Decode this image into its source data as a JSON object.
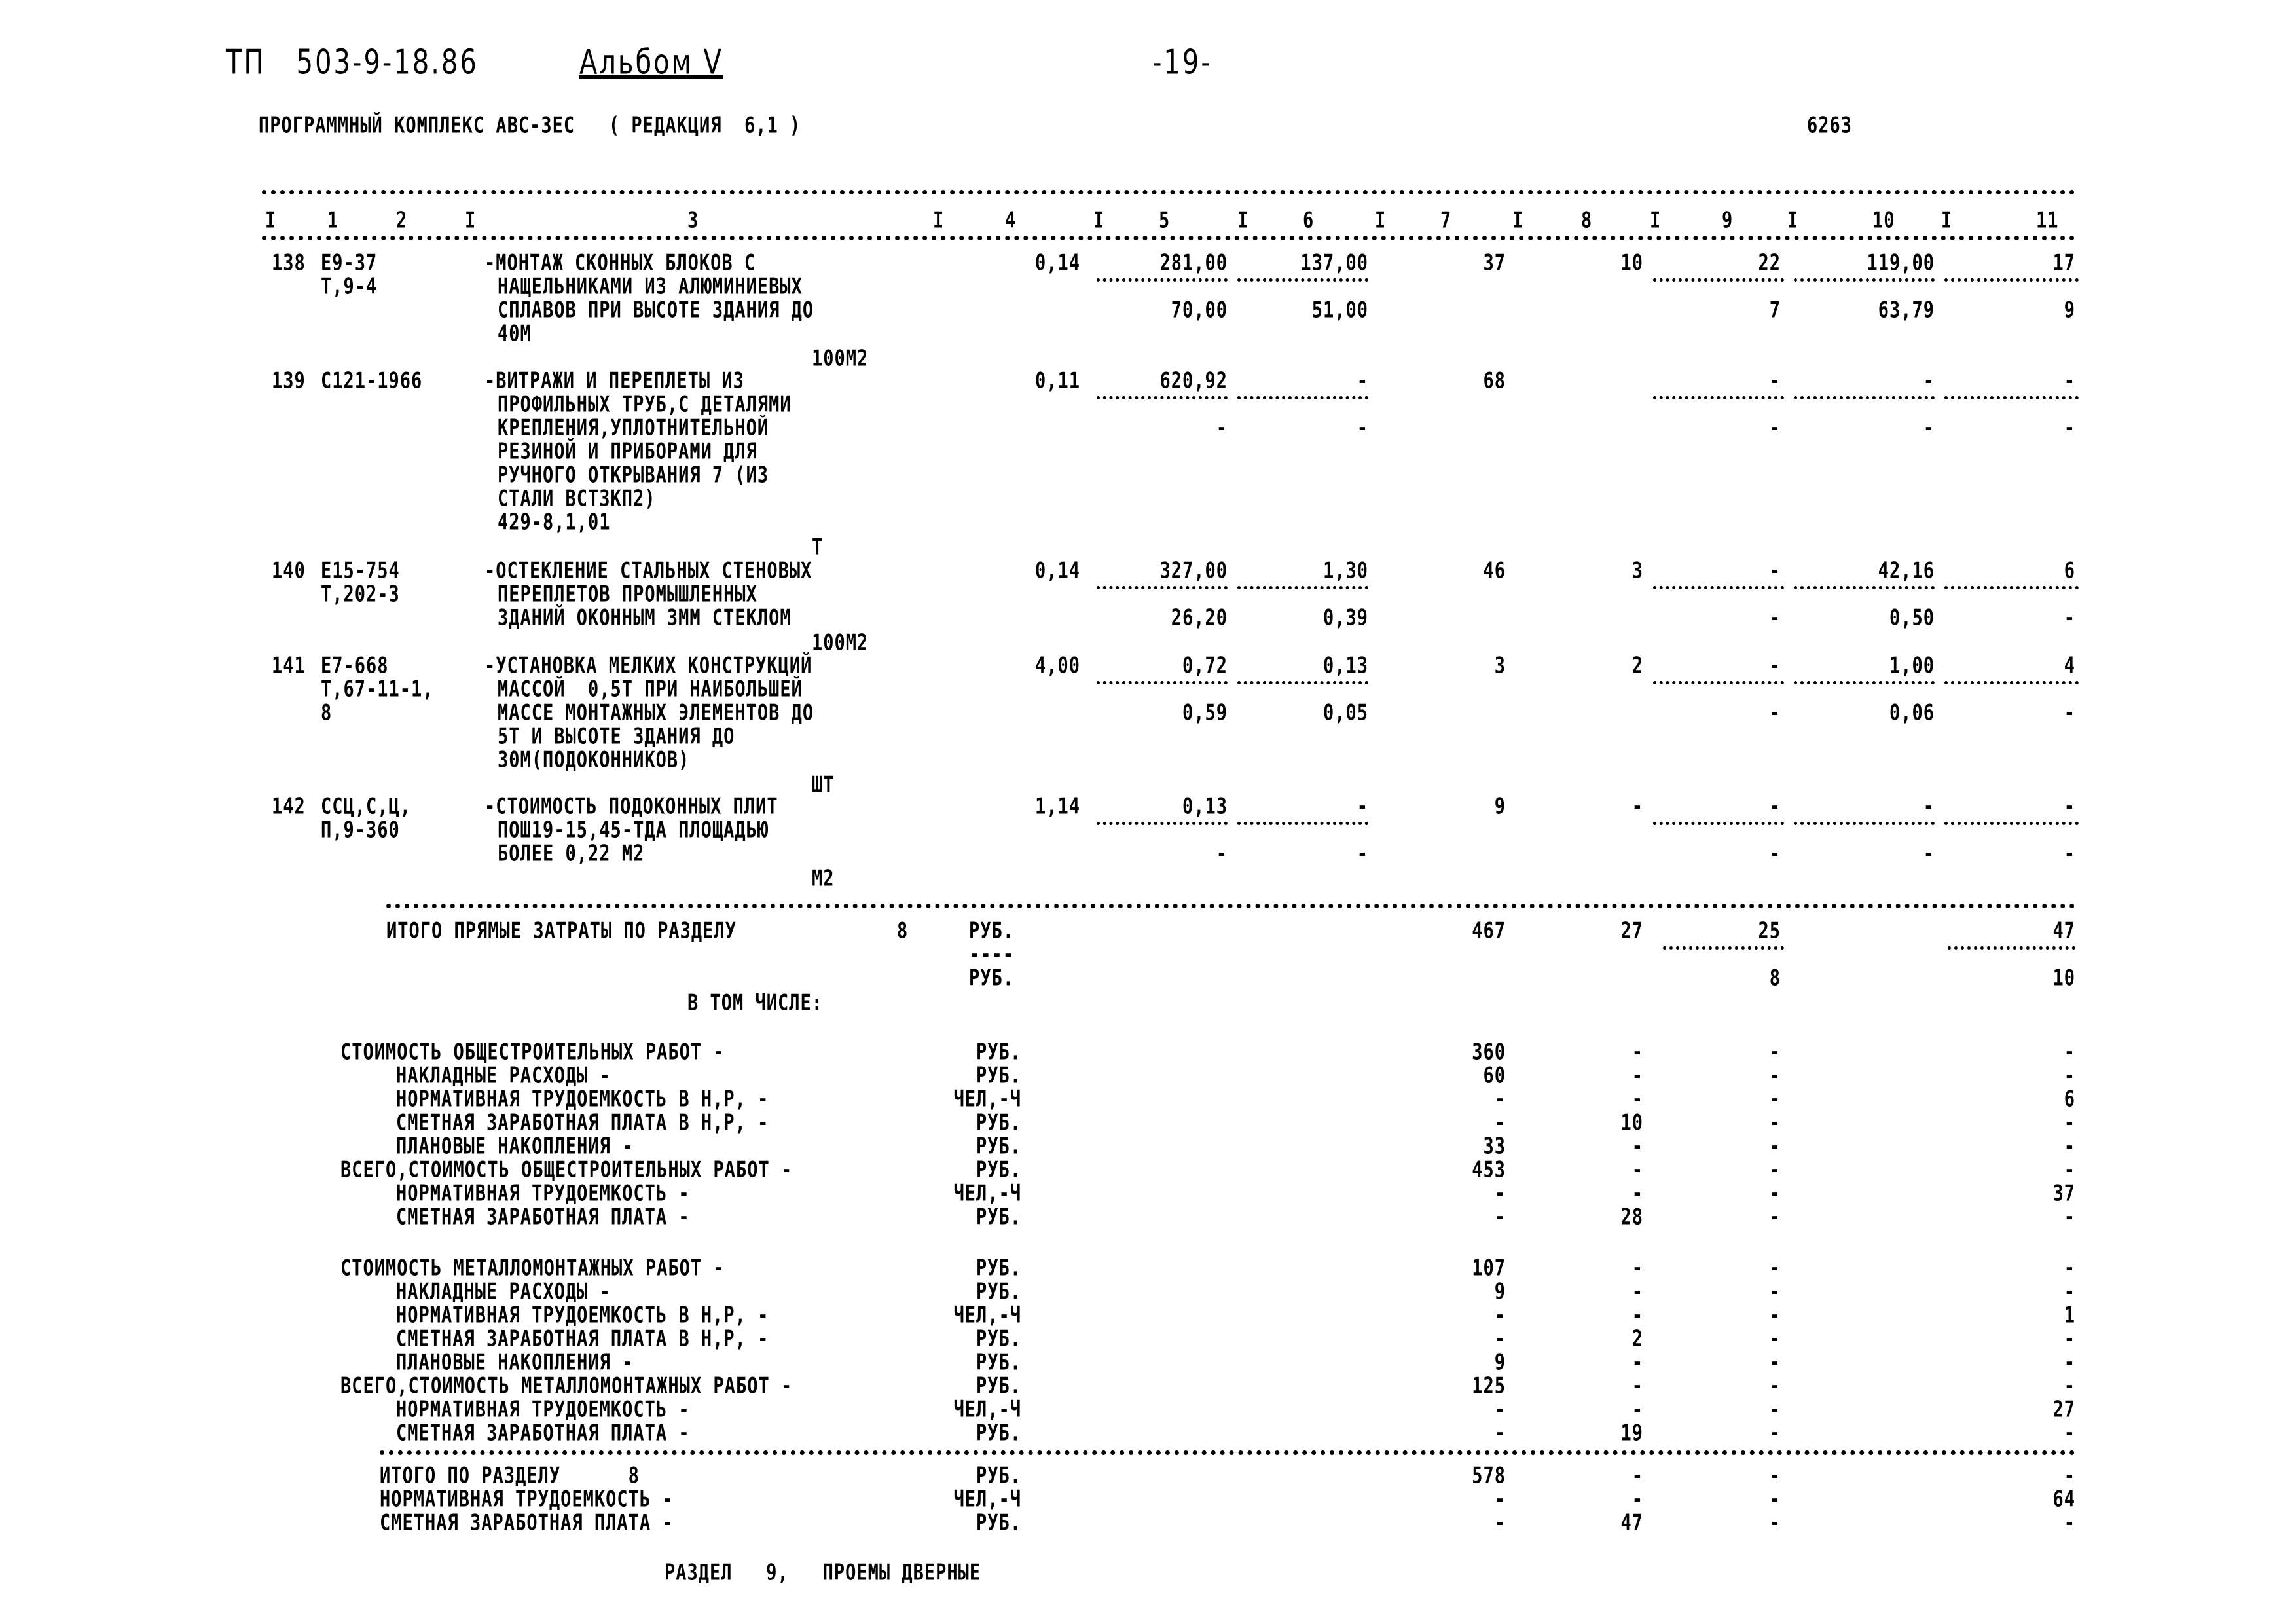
{
  "header": {
    "doc_code": "ТП   503-9-18.86",
    "album": "Альбом V",
    "page": "-19-",
    "program": "ПРОГРАММНЫЙ КОМПЛЕКС АВС-3ЕС   ( РЕДАКЦИЯ  6,1 )",
    "sheet_no": "6263"
  },
  "columns": [
    "1",
    "2",
    "3",
    "4",
    "5",
    "6",
    "7",
    "8",
    "9",
    "10",
    "11"
  ],
  "rows": [
    {
      "num": "138",
      "code": [
        "Е9-37",
        "Т,9-4"
      ],
      "desc": [
        "-МОНТАЖ СКОННЫХ БЛОКОВ С",
        "НАЩЕЛЬНИКАМИ ИЗ АЛЮМИНИЕВЫХ",
        "СПЛАВОВ ПРИ ВЫСОТЕ ЗДАНИЯ ДО",
        "40М"
      ],
      "unit": "100М2",
      "qty": "0,14",
      "c5": [
        "281,00",
        "70,00"
      ],
      "c6": [
        "137,00",
        "51,00"
      ],
      "c7": "37",
      "c8": "10",
      "c9": [
        "22",
        "7"
      ],
      "c10": [
        "119,00",
        "63,79"
      ],
      "c11": [
        "17",
        "9"
      ]
    },
    {
      "num": "139",
      "code": [
        "С121-1966"
      ],
      "desc": [
        "-ВИТРАЖИ И ПЕРЕПЛЕТЫ ИЗ",
        "ПРОФИЛЬНЫХ ТРУБ,С ДЕТАЛЯМИ",
        "КРЕПЛЕНИЯ,УПЛОТНИТЕЛЬНОЙ",
        "РЕЗИНОЙ И ПРИБОРАМИ ДЛЯ",
        "РУЧНОГО ОТКРЫВАНИЯ 7 (ИЗ",
        "СТАЛИ ВСТ3КП2)",
        "429-8,1,01"
      ],
      "unit": "Т",
      "qty": "0,11",
      "c5": [
        "620,92",
        "-"
      ],
      "c6": [
        "-",
        "-"
      ],
      "c7": "68",
      "c8": "",
      "c9": [
        "-",
        "-"
      ],
      "c10": [
        "-",
        "-"
      ],
      "c11": [
        "-",
        "-"
      ]
    },
    {
      "num": "140",
      "code": [
        "Е15-754",
        "Т,202-3"
      ],
      "desc": [
        "-ОСТЕКЛЕНИЕ СТАЛЬНЫХ СТЕНОВЫХ",
        "ПЕРЕПЛЕТОВ ПРОМЫШЛЕННЫХ",
        "ЗДАНИЙ ОКОННЫМ 3ММ СТЕКЛОМ"
      ],
      "unit": "100М2",
      "qty": "0,14",
      "c5": [
        "327,00",
        "26,20"
      ],
      "c6": [
        "1,30",
        "0,39"
      ],
      "c7": "46",
      "c8": "3",
      "c9": [
        "-",
        "-"
      ],
      "c10": [
        "42,16",
        "0,50"
      ],
      "c11": [
        "6",
        "-"
      ]
    },
    {
      "num": "141",
      "code": [
        "Е7-668",
        "Т,67-11-1,",
        "8"
      ],
      "desc": [
        "-УСТАНОВКА МЕЛКИХ КОНСТРУКЦИЙ",
        "МАССОЙ  0,5Т ПРИ НАИБОЛЬШЕЙ",
        "МАССЕ МОНТАЖНЫХ ЭЛЕМЕНТОВ ДО",
        "5Т И ВЫСОТЕ ЗДАНИЯ ДО",
        "30М(ПОДОКОННИКОВ)"
      ],
      "unit": "ШТ",
      "qty": "4,00",
      "c5": [
        "0,72",
        "0,59"
      ],
      "c6": [
        "0,13",
        "0,05"
      ],
      "c7": "3",
      "c8": "2",
      "c9": [
        "-",
        "-"
      ],
      "c10": [
        "1,00",
        "0,06"
      ],
      "c11": [
        "4",
        "-"
      ]
    },
    {
      "num": "142",
      "code": [
        "ССЦ,С,Ц,",
        "П,9-360"
      ],
      "desc": [
        "-СТОИМОСТЬ ПОДОКОННЫХ ПЛИТ",
        "ПОШ19-15,45-ТДА ПЛОЩАДЬЮ",
        "БОЛЕЕ 0,22 М2"
      ],
      "unit": "М2",
      "qty": "1,14",
      "c5": [
        "0,13",
        "-"
      ],
      "c6": [
        "-",
        "-"
      ],
      "c7": "9",
      "c8": "-",
      "c9": [
        "-",
        "-"
      ],
      "c10": [
        "-",
        "-"
      ],
      "c11": [
        "-",
        "-"
      ]
    }
  ],
  "direct_total": {
    "label": "ИТОГО ПРЯМЫЕ ЗАТРАТЫ ПО РАЗДЕЛУ",
    "section": "8",
    "unit1": "РУБ.",
    "unit_sep": "----",
    "unit2": "РУБ.",
    "c7": "467",
    "c8": "27",
    "c9": [
      "25",
      "8"
    ],
    "c11": [
      "47",
      "10"
    ]
  },
  "including_label": "В ТОМ ЧИСЛЕ:",
  "summary_blocks": [
    {
      "lines": [
        {
          "label": "СТОИМОСТЬ ОБЩЕСТРОИТЕЛЬНЫХ РАБОТ -",
          "indent": false,
          "unit": "РУБ.",
          "c7": "360",
          "c8": "-",
          "c9": "-",
          "c11": "-"
        },
        {
          "label": "НАКЛАДНЫЕ РАСХОДЫ -",
          "indent": true,
          "unit": "РУБ.",
          "c7": "60",
          "c8": "-",
          "c9": "-",
          "c11": "-"
        },
        {
          "label": "НОРМАТИВНАЯ ТРУДОЕМКОСТЬ В Н,Р, -",
          "indent": true,
          "unit": "ЧЕЛ,-Ч",
          "c7": "-",
          "c8": "-",
          "c9": "-",
          "c11": "6"
        },
        {
          "label": "СМЕТНАЯ ЗАРАБОТНАЯ ПЛАТА В Н,Р, -",
          "indent": true,
          "unit": "РУБ.",
          "c7": "-",
          "c8": "10",
          "c9": "-",
          "c11": "-"
        },
        {
          "label": "ПЛАНОВЫЕ НАКОПЛЕНИЯ -",
          "indent": true,
          "unit": "РУБ.",
          "c7": "33",
          "c8": "-",
          "c9": "-",
          "c11": "-"
        },
        {
          "label": "ВСЕГО,СТОИМОСТЬ ОБЩЕСТРОИТЕЛЬНЫХ РАБОТ -",
          "indent": false,
          "unit": "РУБ.",
          "c7": "453",
          "c8": "-",
          "c9": "-",
          "c11": "-"
        },
        {
          "label": "НОРМАТИВНАЯ ТРУДОЕМКОСТЬ -",
          "indent": true,
          "unit": "ЧЕЛ,-Ч",
          "c7": "-",
          "c8": "-",
          "c9": "-",
          "c11": "37"
        },
        {
          "label": "СМЕТНАЯ ЗАРАБОТНАЯ ПЛАТА -",
          "indent": true,
          "unit": "РУБ.",
          "c7": "-",
          "c8": "28",
          "c9": "-",
          "c11": "-"
        }
      ]
    },
    {
      "lines": [
        {
          "label": "СТОИМОСТЬ МЕТАЛЛОМОНТАЖНЫХ РАБОТ -",
          "indent": false,
          "unit": "РУБ.",
          "c7": "107",
          "c8": "-",
          "c9": "-",
          "c11": "-"
        },
        {
          "label": "НАКЛАДНЫЕ РАСХОДЫ -",
          "indent": true,
          "unit": "РУБ.",
          "c7": "9",
          "c8": "-",
          "c9": "-",
          "c11": "-"
        },
        {
          "label": "НОРМАТИВНАЯ ТРУДОЕМКОСТЬ В Н,Р, -",
          "indent": true,
          "unit": "ЧЕЛ,-Ч",
          "c7": "-",
          "c8": "-",
          "c9": "-",
          "c11": "1"
        },
        {
          "label": "СМЕТНАЯ ЗАРАБОТНАЯ ПЛАТА В Н,Р, -",
          "indent": true,
          "unit": "РУБ.",
          "c7": "-",
          "c8": "2",
          "c9": "-",
          "c11": "-"
        },
        {
          "label": "ПЛАНОВЫЕ НАКОПЛЕНИЯ -",
          "indent": true,
          "unit": "РУБ.",
          "c7": "9",
          "c8": "-",
          "c9": "-",
          "c11": "-"
        },
        {
          "label": "ВСЕГО,СТОИМОСТЬ МЕТАЛЛОМОНТАЖНЫХ РАБОТ -",
          "indent": false,
          "unit": "РУБ.",
          "c7": "125",
          "c8": "-",
          "c9": "-",
          "c11": "-"
        },
        {
          "label": "НОРМАТИВНАЯ ТРУДОЕМКОСТЬ -",
          "indent": true,
          "unit": "ЧЕЛ,-Ч",
          "c7": "-",
          "c8": "-",
          "c9": "-",
          "c11": "27"
        },
        {
          "label": "СМЕТНАЯ ЗАРАБОТНАЯ ПЛАТА -",
          "indent": true,
          "unit": "РУБ.",
          "c7": "-",
          "c8": "19",
          "c9": "-",
          "c11": "-"
        }
      ]
    }
  ],
  "section_total": {
    "lines": [
      {
        "label": "ИТОГО ПО РАЗДЕЛУ      8",
        "unit": "РУБ.",
        "c7": "578",
        "c8": "-",
        "c9": "-",
        "c11": "-"
      },
      {
        "label": "НОРМАТИВНАЯ ТРУДОЕМКОСТЬ -",
        "unit": "ЧЕЛ,-Ч",
        "c7": "-",
        "c8": "-",
        "c9": "-",
        "c11": "64"
      },
      {
        "label": "СМЕТНАЯ ЗАРАБОТНАЯ ПЛАТА -",
        "unit": "РУБ.",
        "c7": "-",
        "c8": "47",
        "c9": "-",
        "c11": "-"
      }
    ]
  },
  "next_section": "РАЗДЕЛ   9,   ПРОЕМЫ ДВЕРНЫЕ"
}
